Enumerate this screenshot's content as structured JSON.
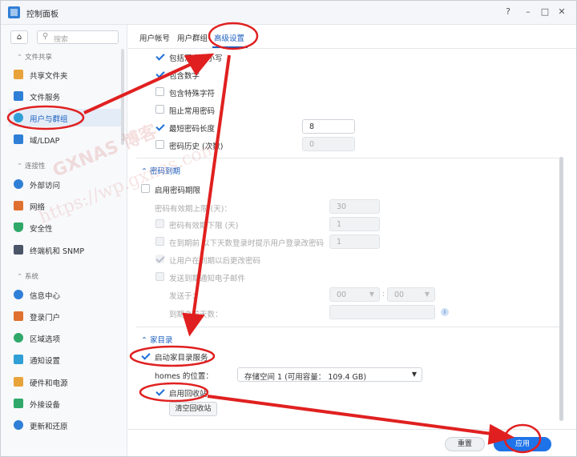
{
  "window": {
    "title": "控制面板",
    "help": "?",
    "minimize": "–",
    "maximize": "□",
    "close": "✕"
  },
  "sidebar": {
    "search_placeholder": "搜索",
    "sections": [
      {
        "label": "文件共享"
      },
      {
        "label": "连接性"
      },
      {
        "label": "系统"
      }
    ],
    "items": [
      {
        "label": "共享文件夹",
        "color": "#e8a33a"
      },
      {
        "label": "文件服务",
        "color": "#2f7fd6"
      },
      {
        "label": "用户与群组",
        "color": "#2f9fd6"
      },
      {
        "label": "域/LDAP",
        "color": "#2f7fd6"
      },
      {
        "label": "外部访问",
        "color": "#2f7fd6"
      },
      {
        "label": "网络",
        "color": "#e0702f"
      },
      {
        "label": "安全性",
        "color": "#2fa86a"
      },
      {
        "label": "终端机和 SNMP",
        "color": "#4a5568"
      },
      {
        "label": "信息中心",
        "color": "#2f7fd6"
      },
      {
        "label": "登录门户",
        "color": "#e0702f"
      },
      {
        "label": "区域选项",
        "color": "#2fa86a"
      },
      {
        "label": "通知设置",
        "color": "#2f9fd6"
      },
      {
        "label": "硬件和电源",
        "color": "#e8a33a"
      },
      {
        "label": "外接设备",
        "color": "#2fa86a"
      },
      {
        "label": "更新和还原",
        "color": "#2f7fd6"
      }
    ]
  },
  "tabs": [
    "用户帐号",
    "用户群组",
    "高级设置"
  ],
  "password_rules": {
    "include_case": "包括混合大小写",
    "include_digits": "包含数字",
    "include_special": "包含特殊字符",
    "block_common": "阻止常用密码",
    "min_length": "最短密码长度",
    "min_length_value": "8",
    "history": "密码历史 (次数)",
    "history_value": "0"
  },
  "expiry": {
    "heading": "密码到期",
    "enable": "启用密码期限",
    "max_age": "密码有效期上限 (天)：",
    "max_age_value": "30",
    "min_age": "密码有效期下限 (天)",
    "min_age_value": "1",
    "notify_login": "在到期前       以下天数登录时提示用户登录改密码",
    "notify_login_value": "1",
    "allow_change": "让用户在到期以后更改密码",
    "email": "发送到期通知电子邮件",
    "send_at": "发送于：",
    "hour": "00",
    "minute": "00",
    "days_before": "到期之前天数："
  },
  "home": {
    "heading": "家目录",
    "enable": "启动家目录服务",
    "location_label": "homes 的位置：",
    "location_value": "存储空间 1 (可用容量： 109.4 GB)",
    "recycle": "启用回收站",
    "empty_recycle": "清空回收站"
  },
  "footer": {
    "reset": "重置",
    "apply": "应用"
  },
  "watermark": {
    "line1": "GXNAS 博客",
    "line2": "https://wp.gxnas.com"
  },
  "annotation_color": "#e02020"
}
